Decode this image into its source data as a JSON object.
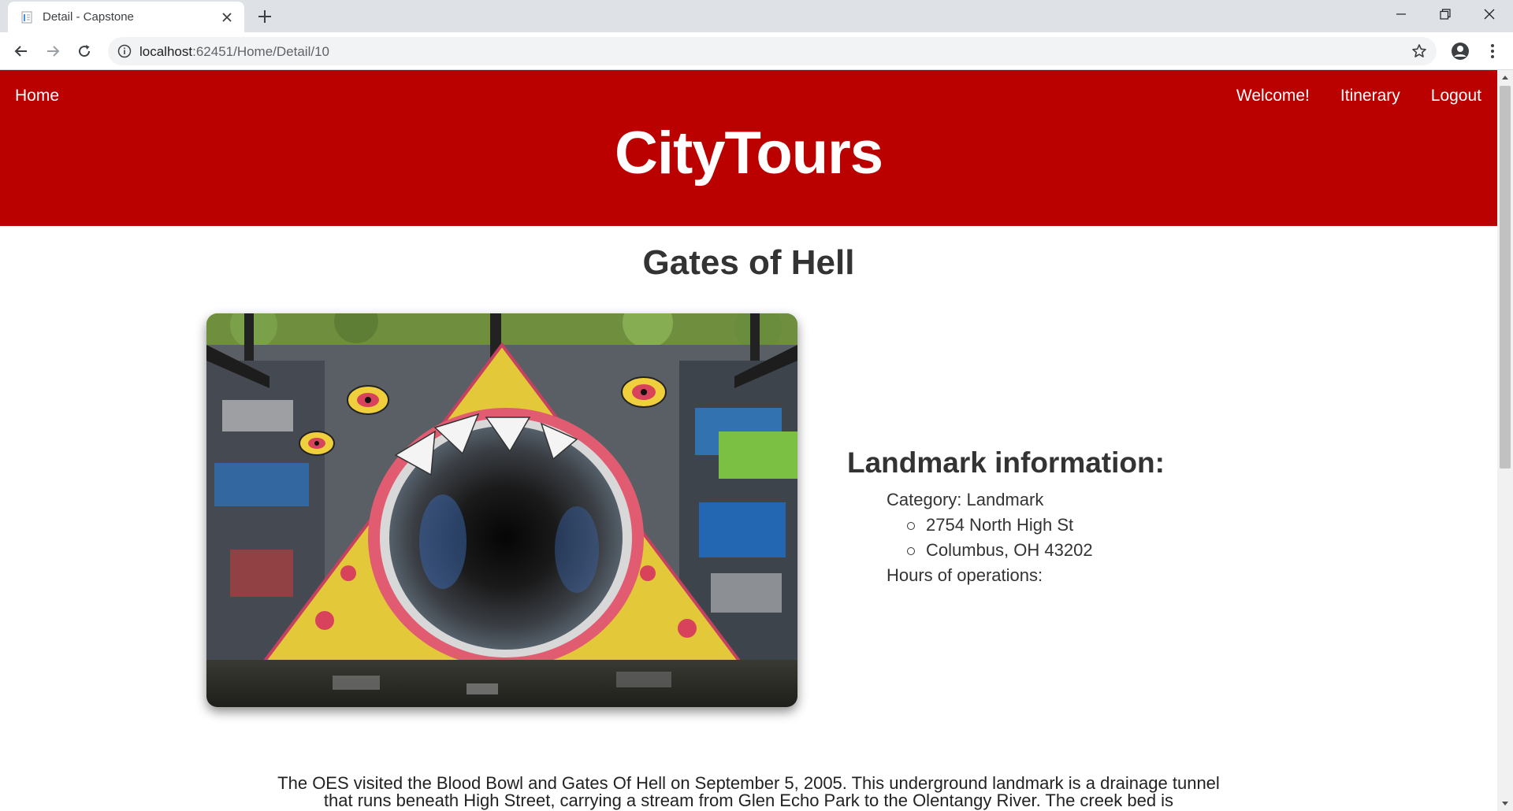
{
  "browser": {
    "tab_title": "Detail - Capstone",
    "url_host": "localhost",
    "url_path": ":62451/Home/Detail/10"
  },
  "site": {
    "nav": {
      "home": "Home",
      "welcome": "Welcome!",
      "itinerary": "Itinerary",
      "logout": "Logout"
    },
    "brand": "CityTours"
  },
  "landmark": {
    "name": "Gates of Hell",
    "info_heading": "Landmark information:",
    "category": "Category: Landmark",
    "address_line1": "2754 North High St",
    "address_line2": "Columbus, OH 43202",
    "hours": "Hours of operations:",
    "description": "The OES visited the Blood Bowl and Gates Of Hell on September 5, 2005. This underground landmark is a drainage tunnel that runs beneath High Street, carrying a stream from Glen Echo Park to the Olentangy River. The creek bed is"
  },
  "colors": {
    "header_red": "#bb0000",
    "chrome_gray": "#dee1e6"
  },
  "icons": [
    "page-favicon",
    "close-icon",
    "plus-icon",
    "minimize-icon",
    "restore-icon",
    "back-arrow-icon",
    "forward-arrow-icon",
    "reload-icon",
    "info-icon",
    "star-icon",
    "account-icon",
    "kebab-menu-icon"
  ]
}
